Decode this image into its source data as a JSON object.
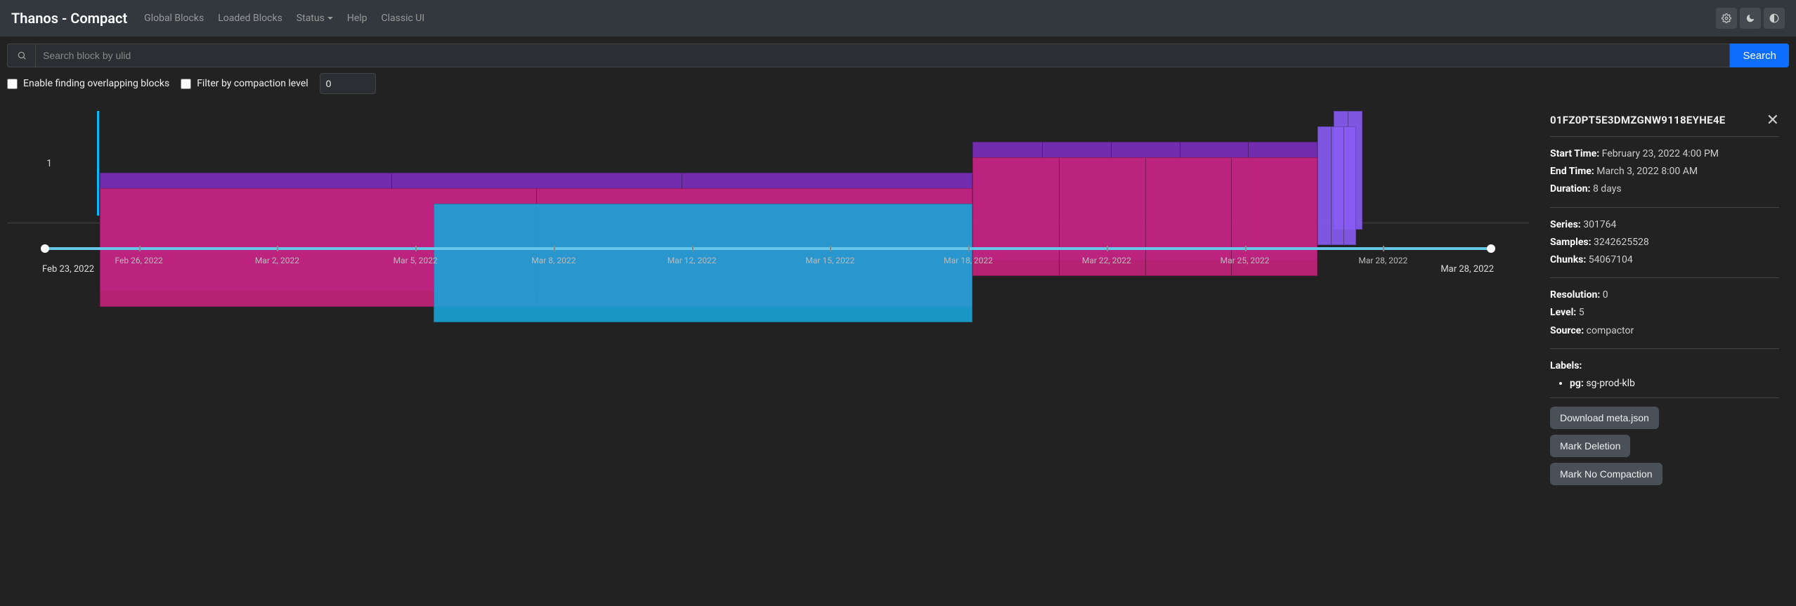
{
  "brand": "Thanos - Compact",
  "nav": {
    "global_blocks": "Global Blocks",
    "loaded_blocks": "Loaded Blocks",
    "status": "Status",
    "help": "Help",
    "classic_ui": "Classic UI"
  },
  "search": {
    "placeholder": "Search block by ulid",
    "button": "Search"
  },
  "controls": {
    "overlap_label": "Enable finding overlapping blocks",
    "filter_label": "Filter by compaction level",
    "filter_value": "0"
  },
  "chart": {
    "y_label": "1",
    "range_start": "Feb 23, 2022",
    "range_end": "Mar 28, 2022",
    "ticks": [
      "Feb 26, 2022",
      "Mar 2, 2022",
      "Mar 5, 2022",
      "Mar 8, 2022",
      "Mar 12, 2022",
      "Mar 15, 2022",
      "Mar 18, 2022",
      "Mar 22, 2022",
      "Mar 25, 2022",
      "Mar 28, 2022"
    ]
  },
  "chart_data": {
    "type": "bar",
    "x_range": [
      "2022-02-23",
      "2022-03-28"
    ],
    "tracks": [
      {
        "row": 0,
        "color": "violet",
        "start_pct": 86.4,
        "end_pct": 88.4,
        "segments": 2
      },
      {
        "row": 1,
        "color": "violet",
        "start_pct": 85.3,
        "end_pct": 88.0,
        "segments": 3
      },
      {
        "row": 2,
        "color": "purple",
        "start_pct": 61.3,
        "end_pct": 85.3,
        "segments": 5
      },
      {
        "row": 3,
        "color": "magenta",
        "start_pct": 61.3,
        "end_pct": 85.3,
        "segments": 4
      },
      {
        "row": 4,
        "color": "purple",
        "start_pct": 0.6,
        "end_pct": 61.3,
        "segments": 3
      },
      {
        "row": 5,
        "color": "magenta",
        "start_pct": 0.6,
        "end_pct": 61.3,
        "segments": 2
      },
      {
        "row": 6,
        "color": "cyan",
        "start_pct": 23.8,
        "end_pct": 61.3,
        "segments": 1
      }
    ]
  },
  "details": {
    "ulid": "01FZ0PT5E3DMZGNW9118EYHE4E",
    "start_time_label": "Start Time:",
    "start_time": "February 23, 2022 4:00 PM",
    "end_time_label": "End Time:",
    "end_time": "March 3, 2022 8:00 AM",
    "duration_label": "Duration:",
    "duration": "8 days",
    "series_label": "Series:",
    "series": "301764",
    "samples_label": "Samples:",
    "samples": "3242625528",
    "chunks_label": "Chunks:",
    "chunks": "54067104",
    "resolution_label": "Resolution:",
    "resolution": "0",
    "level_label": "Level:",
    "level": "5",
    "source_label": "Source:",
    "source": "compactor",
    "labels_label": "Labels:",
    "label_key": "pg:",
    "label_val": "sg-prod-klb",
    "btn_download": "Download meta.json",
    "btn_delete": "Mark Deletion",
    "btn_nocompact": "Mark No Compaction"
  }
}
